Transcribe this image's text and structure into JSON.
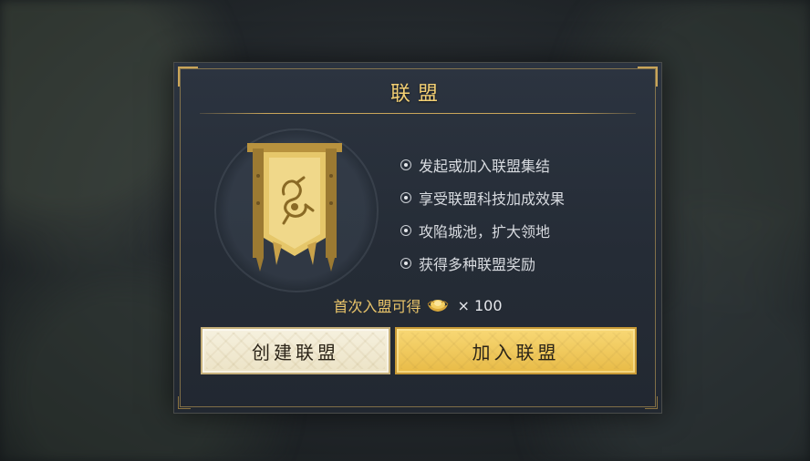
{
  "dialog": {
    "title": "联盟",
    "features": [
      "发起或加入联盟集结",
      "享受联盟科技加成效果",
      "攻陷城池，扩大领地",
      "获得多种联盟奖励"
    ],
    "reward": {
      "label": "首次入盟可得",
      "icon": "gold-ingot-icon",
      "amount": "× 100"
    },
    "buttons": {
      "create": "创建联盟",
      "join": "加入联盟"
    }
  },
  "colors": {
    "accent_gold": "#f2cf73",
    "join_button": "#e8bb47",
    "create_button": "#f6f1df",
    "panel": "#2c3440"
  }
}
